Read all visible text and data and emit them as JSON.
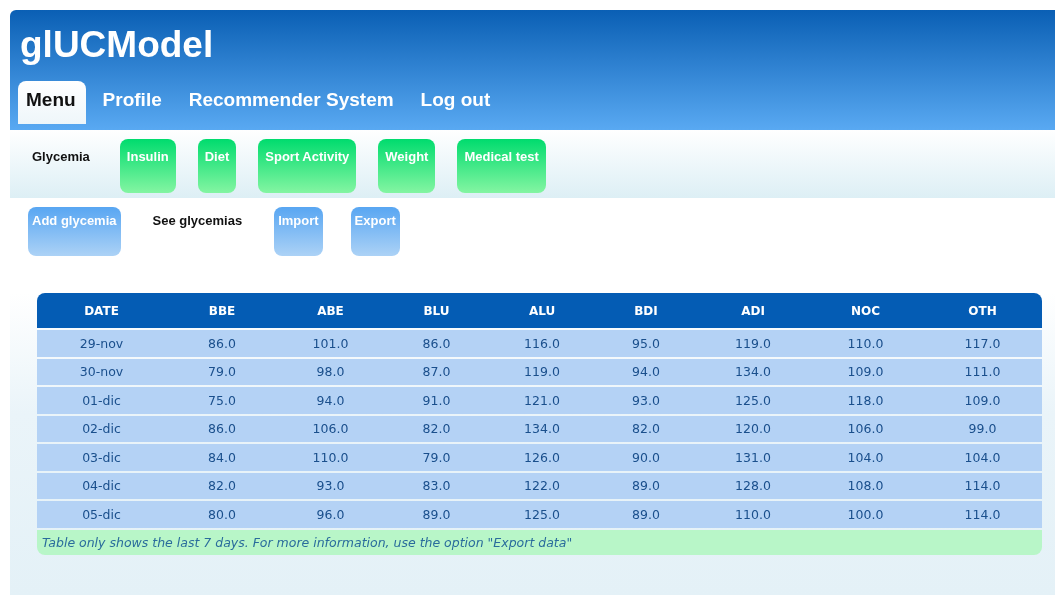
{
  "app": {
    "title": "glUCModel"
  },
  "tabs": [
    {
      "label": "Menu",
      "selected": true
    },
    {
      "label": "Profile",
      "selected": false
    },
    {
      "label": "Recommender System",
      "selected": false
    },
    {
      "label": "Log out",
      "selected": false
    }
  ],
  "submenu": [
    {
      "label": "Glycemia",
      "selected": true
    },
    {
      "label": "Insulin",
      "selected": false
    },
    {
      "label": "Diet",
      "selected": false
    },
    {
      "label": "Sport Activity",
      "selected": false
    },
    {
      "label": "Weight",
      "selected": false
    },
    {
      "label": "Medical test",
      "selected": false
    }
  ],
  "actions": [
    {
      "label": "Add glycemia",
      "selected": false
    },
    {
      "label": "See glycemias",
      "selected": true
    },
    {
      "label": "Import",
      "selected": false
    },
    {
      "label": "Export",
      "selected": false
    }
  ],
  "table": {
    "columns": [
      "DATE",
      "BBE",
      "ABE",
      "BLU",
      "ALU",
      "BDI",
      "ADI",
      "NOC",
      "OTH"
    ],
    "rows": [
      [
        "29-nov",
        "86.0",
        "101.0",
        "86.0",
        "116.0",
        "95.0",
        "119.0",
        "110.0",
        "117.0"
      ],
      [
        "30-nov",
        "79.0",
        "98.0",
        "87.0",
        "119.0",
        "94.0",
        "134.0",
        "109.0",
        "111.0"
      ],
      [
        "01-dic",
        "75.0",
        "94.0",
        "91.0",
        "121.0",
        "93.0",
        "125.0",
        "118.0",
        "109.0"
      ],
      [
        "02-dic",
        "86.0",
        "106.0",
        "82.0",
        "134.0",
        "82.0",
        "120.0",
        "106.0",
        "99.0"
      ],
      [
        "03-dic",
        "84.0",
        "110.0",
        "79.0",
        "126.0",
        "90.0",
        "131.0",
        "104.0",
        "104.0"
      ],
      [
        "04-dic",
        "82.0",
        "93.0",
        "83.0",
        "122.0",
        "89.0",
        "128.0",
        "108.0",
        "114.0"
      ],
      [
        "05-dic",
        "80.0",
        "96.0",
        "89.0",
        "125.0",
        "89.0",
        "110.0",
        "100.0",
        "114.0"
      ]
    ],
    "footnote": "Table only shows the last 7 days. For more information, use the option \"Export data\""
  }
}
